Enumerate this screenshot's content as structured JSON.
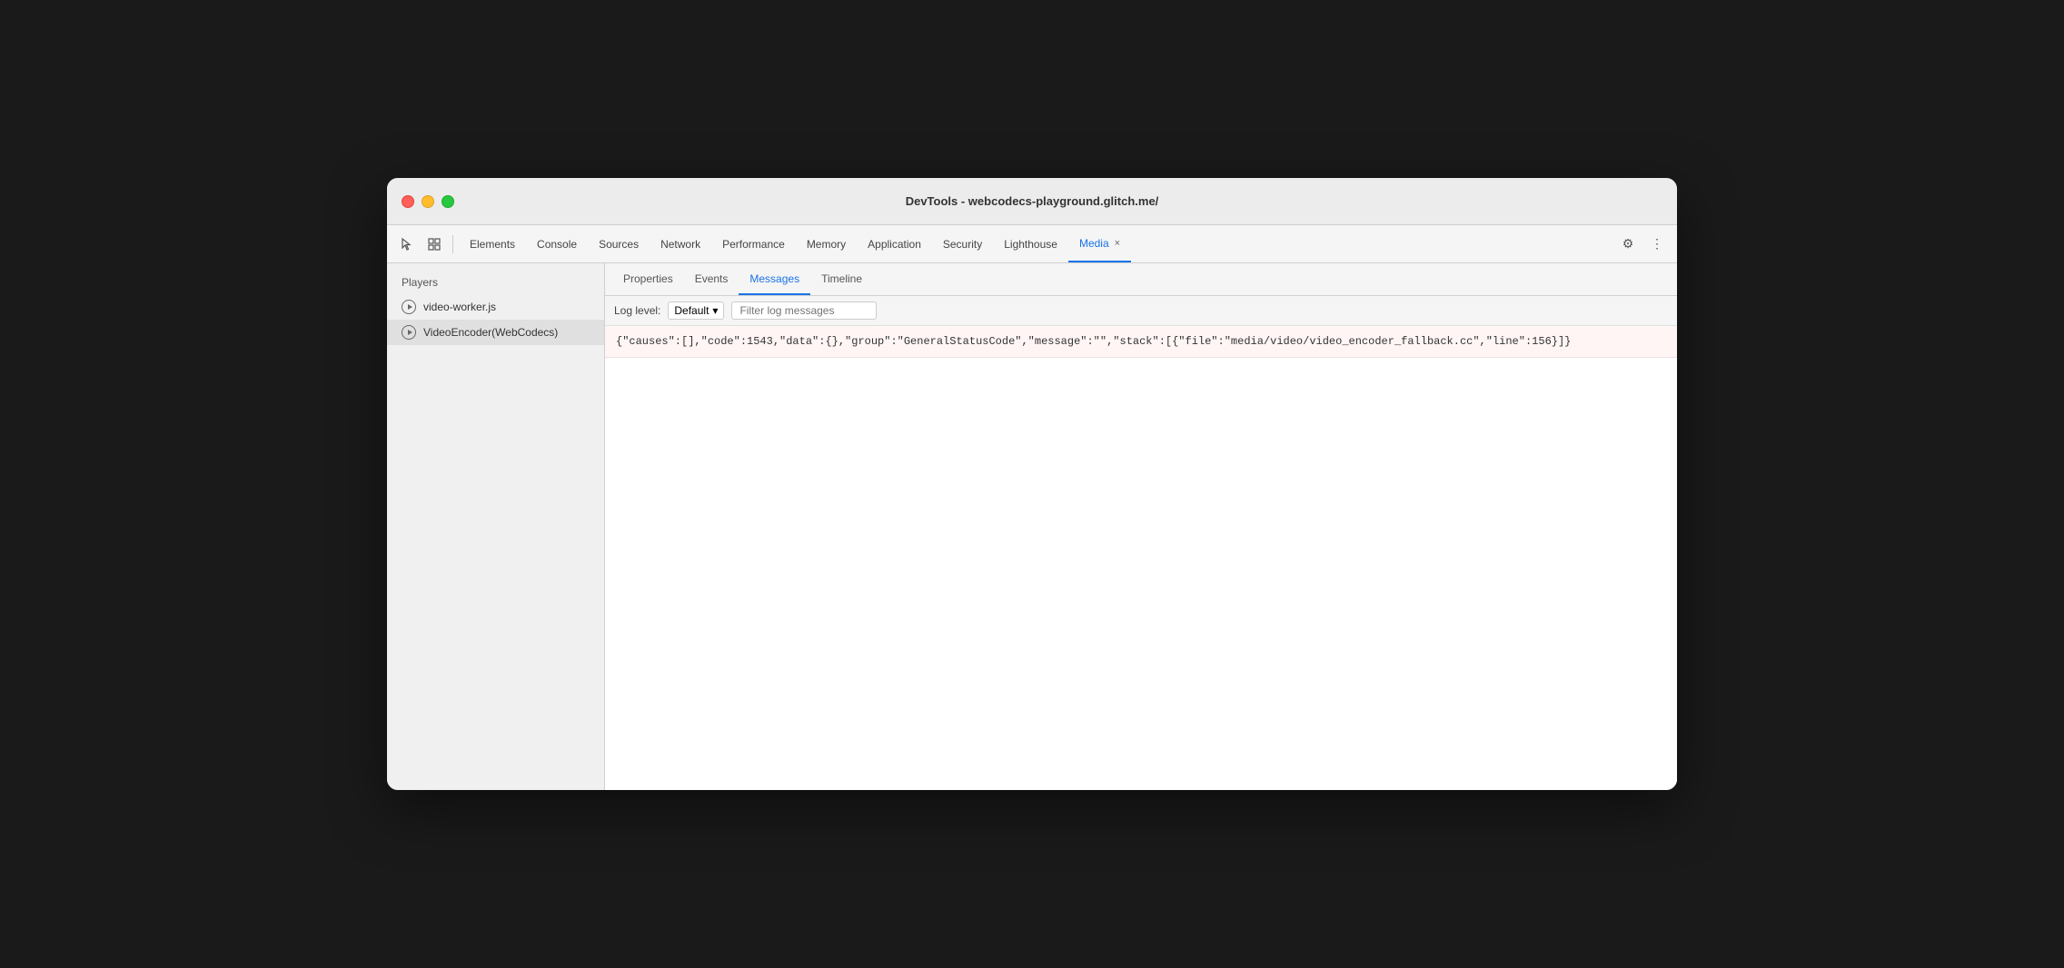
{
  "window": {
    "title": "DevTools - webcodecs-playground.glitch.me/"
  },
  "toolbar": {
    "tabs": [
      {
        "id": "elements",
        "label": "Elements",
        "active": false
      },
      {
        "id": "console",
        "label": "Console",
        "active": false
      },
      {
        "id": "sources",
        "label": "Sources",
        "active": false
      },
      {
        "id": "network",
        "label": "Network",
        "active": false
      },
      {
        "id": "performance",
        "label": "Performance",
        "active": false
      },
      {
        "id": "memory",
        "label": "Memory",
        "active": false
      },
      {
        "id": "application",
        "label": "Application",
        "active": false
      },
      {
        "id": "security",
        "label": "Security",
        "active": false
      },
      {
        "id": "lighthouse",
        "label": "Lighthouse",
        "active": false
      },
      {
        "id": "media",
        "label": "Media",
        "active": true,
        "closeable": true
      }
    ]
  },
  "sidebar": {
    "header": "Players",
    "items": [
      {
        "id": "video-worker",
        "label": "video-worker.js",
        "selected": false
      },
      {
        "id": "video-encoder",
        "label": "VideoEncoder(WebCodecs)",
        "selected": true
      }
    ]
  },
  "content": {
    "tabs": [
      {
        "id": "properties",
        "label": "Properties",
        "active": false
      },
      {
        "id": "events",
        "label": "Events",
        "active": false
      },
      {
        "id": "messages",
        "label": "Messages",
        "active": true
      },
      {
        "id": "timeline",
        "label": "Timeline",
        "active": false
      }
    ],
    "log_toolbar": {
      "label": "Log level:",
      "select_value": "Default",
      "filter_placeholder": "Filter log messages"
    },
    "log_entry": {
      "text": "{\"causes\":[],\"code\":1543,\"data\":{},\"group\":\"GeneralStatusCode\",\"message\":\"\",\"stack\":[{\"file\":\"media/video/video_encoder_fallback.cc\",\"line\":156}]}"
    }
  },
  "icons": {
    "cursor": "⬡",
    "layers": "⬡",
    "settings": "⚙",
    "more": "⋮",
    "chevron_down": "▾"
  },
  "colors": {
    "active_tab": "#1a73e8",
    "error_bg": "#fff5f5",
    "error_border": "#f0e0e0"
  }
}
